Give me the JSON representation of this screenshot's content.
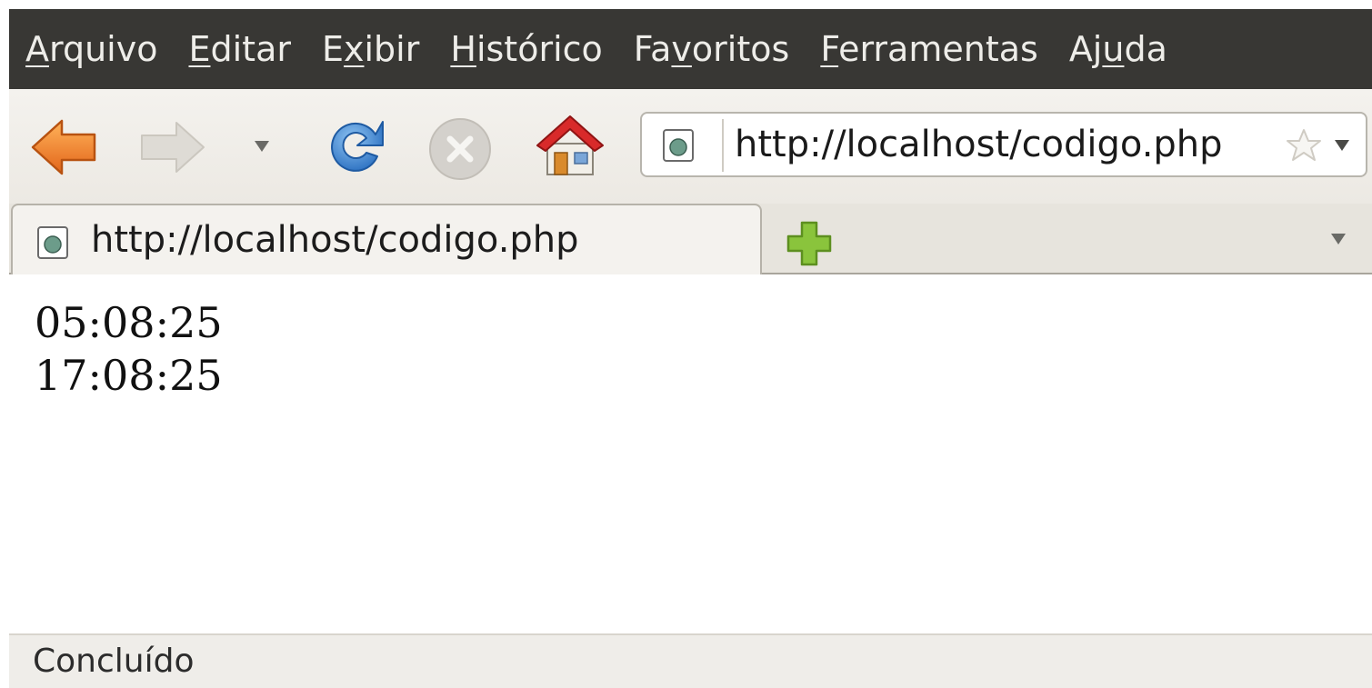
{
  "menubar": {
    "items": [
      {
        "accel": "A",
        "rest": "rquivo"
      },
      {
        "accel": "E",
        "rest": "ditar"
      },
      {
        "pre": "E",
        "accel": "x",
        "rest": "ibir"
      },
      {
        "accel": "H",
        "rest": "istórico"
      },
      {
        "pre": "Fa",
        "accel": "v",
        "rest": "oritos"
      },
      {
        "accel": "F",
        "rest": "erramentas"
      },
      {
        "pre": "Aj",
        "accel": "u",
        "rest": "da"
      }
    ]
  },
  "toolbar": {
    "back_icon": "back-arrow-icon",
    "forward_icon": "forward-arrow-icon",
    "history_dropdown_icon": "chevron-down-icon",
    "reload_icon": "reload-icon",
    "stop_icon": "stop-icon",
    "home_icon": "home-icon"
  },
  "urlbar": {
    "url": "http://localhost/codigo.php",
    "site_icon": "page-icon",
    "bookmark_icon": "star-icon",
    "dropdown_icon": "chevron-down-icon"
  },
  "tabs": [
    {
      "label": "http://localhost/codigo.php",
      "icon": "page-icon"
    }
  ],
  "new_tab_icon": "plus-icon",
  "content": {
    "lines": [
      "05:08:25",
      "17:08:25"
    ]
  },
  "status": {
    "text": "Concluído"
  },
  "colors": {
    "menubar_bg": "#383734",
    "menubar_text": "#eeede9",
    "toolbar_bg": "#efece7",
    "back_arrow": "#f08a2c",
    "reload": "#3a84d0",
    "new_tab_plus": "#8ac43c",
    "home_roof": "#d4282a"
  }
}
